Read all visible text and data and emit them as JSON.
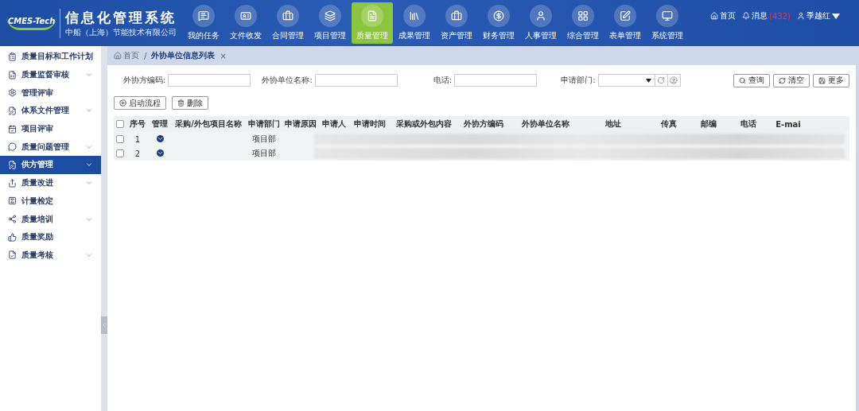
{
  "header": {
    "logo_text": "CMES-Tech",
    "title": "信息化管理系统",
    "subtitle": "中船（上海）节能技术有限公司",
    "nav": [
      {
        "label": "我的任务",
        "selected": false
      },
      {
        "label": "文件收发",
        "selected": false
      },
      {
        "label": "合同管理",
        "selected": false
      },
      {
        "label": "项目管理",
        "selected": false
      },
      {
        "label": "质量管理",
        "selected": true
      },
      {
        "label": "成果管理",
        "selected": false
      },
      {
        "label": "资产管理",
        "selected": false
      },
      {
        "label": "财务管理",
        "selected": false
      },
      {
        "label": "人事管理",
        "selected": false
      },
      {
        "label": "综合管理",
        "selected": false
      },
      {
        "label": "表单管理",
        "selected": false
      },
      {
        "label": "系统管理",
        "selected": false
      }
    ],
    "home": "首页",
    "messages": "消息",
    "message_count": "(432)",
    "user": "季越红"
  },
  "sidebar": {
    "items": [
      {
        "label": "质量目标和工作计划",
        "has_children": false,
        "selected": false
      },
      {
        "label": "质量监督审核",
        "has_children": true,
        "selected": false
      },
      {
        "label": "管理评审",
        "has_children": false,
        "selected": false
      },
      {
        "label": "体系文件管理",
        "has_children": true,
        "selected": false
      },
      {
        "label": "项目评审",
        "has_children": false,
        "selected": false
      },
      {
        "label": "质量问题管理",
        "has_children": true,
        "selected": false
      },
      {
        "label": "供方管理",
        "has_children": true,
        "selected": true
      },
      {
        "label": "质量改进",
        "has_children": true,
        "selected": false
      },
      {
        "label": "计量检定",
        "has_children": false,
        "selected": false
      },
      {
        "label": "质量培训",
        "has_children": true,
        "selected": false
      },
      {
        "label": "质量奖励",
        "has_children": false,
        "selected": false
      },
      {
        "label": "质量考核",
        "has_children": true,
        "selected": false
      }
    ]
  },
  "breadcrumb": {
    "home": "首页",
    "separator": "/",
    "tab": "外协单位信息列表",
    "close": "×"
  },
  "filters": [
    {
      "label": "外协方编码:",
      "kind": "text"
    },
    {
      "label": "外协单位名称:",
      "kind": "text"
    },
    {
      "label": "电话:",
      "kind": "text"
    },
    {
      "label": "申请部门:",
      "kind": "select"
    }
  ],
  "search_buttons": [
    "查询",
    "清空",
    "更多"
  ],
  "actions": [
    "启动流程",
    "删除"
  ],
  "table": {
    "all_checked": false,
    "columns": [
      "序号",
      "管理",
      "采购/外包项目名称",
      "申请部门",
      "申请原因",
      "申请人",
      "申请时间",
      "采购或外包内容",
      "外协方编码",
      "外协单位名称",
      "地址",
      "传真",
      "邮编",
      "电话",
      "E-mai"
    ],
    "rows": [
      {
        "checked": false,
        "number": "1",
        "department": "项目部",
        "blurred": true
      },
      {
        "checked": false,
        "number": "2",
        "department": "项目部",
        "blurred": true
      }
    ]
  }
}
